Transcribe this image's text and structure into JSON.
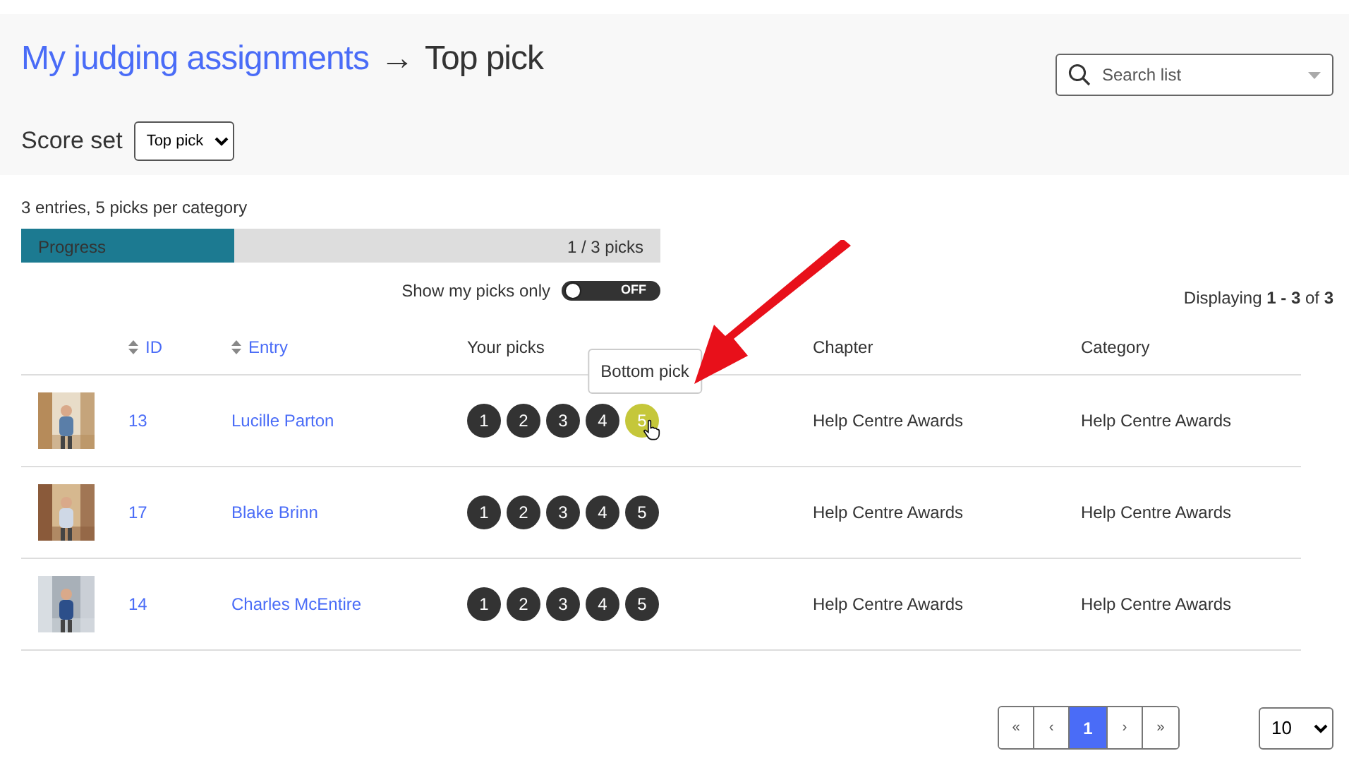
{
  "header": {
    "breadcrumb_link": "My judging assignments",
    "separator": "→",
    "current": "Top pick"
  },
  "search": {
    "placeholder": "Search list"
  },
  "score_set": {
    "label": "Score set",
    "value": "Top pick"
  },
  "summary": "3 entries, 5 picks per category",
  "progress": {
    "label": "Progress",
    "reading": "1 / 3 picks",
    "level": 0.333
  },
  "filter_toggle": {
    "label": "Show my picks only",
    "state_text": "OFF",
    "on": false
  },
  "displaying": "Displaying **1 - 3** of **3**",
  "table": {
    "columns": [
      {
        "label": "ID",
        "sortable": true
      },
      {
        "label": "Entry",
        "sortable": true
      },
      {
        "label": "Your picks",
        "sortable": false
      },
      {
        "label": "Chapter",
        "sortable": false
      },
      {
        "label": "Category",
        "sortable": false
      }
    ],
    "rows": [
      {
        "id": "13",
        "entry": "Lucille Parton",
        "picks": [
          {
            "label": "1",
            "selected": false
          },
          {
            "label": "2",
            "selected": false
          },
          {
            "label": "3",
            "selected": false
          },
          {
            "label": "4",
            "selected": false
          },
          {
            "label": "5",
            "selected": true,
            "tooltip": "Bottom pick"
          }
        ],
        "chapter": "Help Centre Awards",
        "category": "Help Centre Awards"
      },
      {
        "id": "17",
        "entry": "Blake Brinn",
        "picks": [
          {
            "label": "1",
            "selected": false
          },
          {
            "label": "2",
            "selected": false
          },
          {
            "label": "3",
            "selected": false
          },
          {
            "label": "4",
            "selected": false
          },
          {
            "label": "5",
            "selected": false
          }
        ],
        "chapter": "Help Centre Awards",
        "category": "Help Centre Awards"
      },
      {
        "id": "14",
        "entry": "Charles McEntire",
        "picks": [
          {
            "label": "1",
            "selected": false
          },
          {
            "label": "2",
            "selected": false
          },
          {
            "label": "3",
            "selected": false
          },
          {
            "label": "4",
            "selected": false
          },
          {
            "label": "5",
            "selected": false
          }
        ],
        "chapter": "Help Centre Awards",
        "category": "Help Centre Awards"
      }
    ]
  },
  "pagination": [
    {
      "label": "«",
      "selected": false
    },
    {
      "label": "‹",
      "selected": false
    },
    {
      "label": "1",
      "selected": true
    },
    {
      "label": "›",
      "selected": false
    },
    {
      "label": "»",
      "selected": false
    }
  ],
  "per_page": "10"
}
